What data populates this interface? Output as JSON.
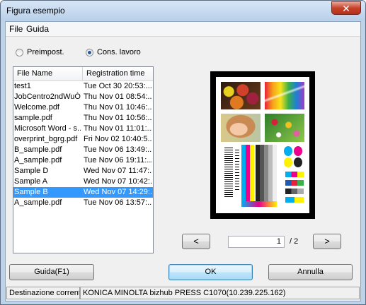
{
  "window": {
    "title": "Figura esempio",
    "close_label": "✕"
  },
  "menu": {
    "file": "File",
    "guida": "Guida"
  },
  "radios": [
    {
      "label": "Preimpost.",
      "selected": false
    },
    {
      "label": "Cons. lavoro",
      "selected": true
    }
  ],
  "file_list": {
    "headers": [
      "File Name",
      "Registration time"
    ],
    "rows": [
      {
        "name": "test1",
        "time": "Tue Oct 30 20:53:..."
      },
      {
        "name": "JobCentro2ndWuÒ...",
        "time": "Thu Nov 01 08:54:..."
      },
      {
        "name": "Welcome.pdf",
        "time": "Thu Nov 01 10:46:..."
      },
      {
        "name": "sample.pdf",
        "time": "Thu Nov 01 10:56:..."
      },
      {
        "name": "Microsoft Word - s...",
        "time": "Thu Nov 01 11:01:..."
      },
      {
        "name": "overprint_bgrg.pdf",
        "time": "Fri Nov 02 10:40:5..."
      },
      {
        "name": "B_sample.pdf",
        "time": "Tue Nov 06 13:49:..."
      },
      {
        "name": "A_sample.pdf",
        "time": "Tue Nov 06 19:11:..."
      },
      {
        "name": "Sample D",
        "time": "Wed Nov 07 11:47:..."
      },
      {
        "name": "Sample A",
        "time": "Wed Nov 07 10:42:..."
      },
      {
        "name": "Sample B",
        "time": "Wed Nov 07 14:29:...",
        "selected": true
      },
      {
        "name": "A_sample.pdf",
        "time": "Tue Nov 06 13:57:..."
      }
    ]
  },
  "pager": {
    "prev": "<",
    "next": ">",
    "current": "1",
    "total": "/ 2"
  },
  "buttons": {
    "help": "Guida(F1)",
    "ok": "OK",
    "cancel": "Annulla"
  },
  "status": {
    "label": "Destinazione corrente",
    "value": "KONICA MINOLTA bizhub PRESS C1070(10.239.225.162)"
  }
}
